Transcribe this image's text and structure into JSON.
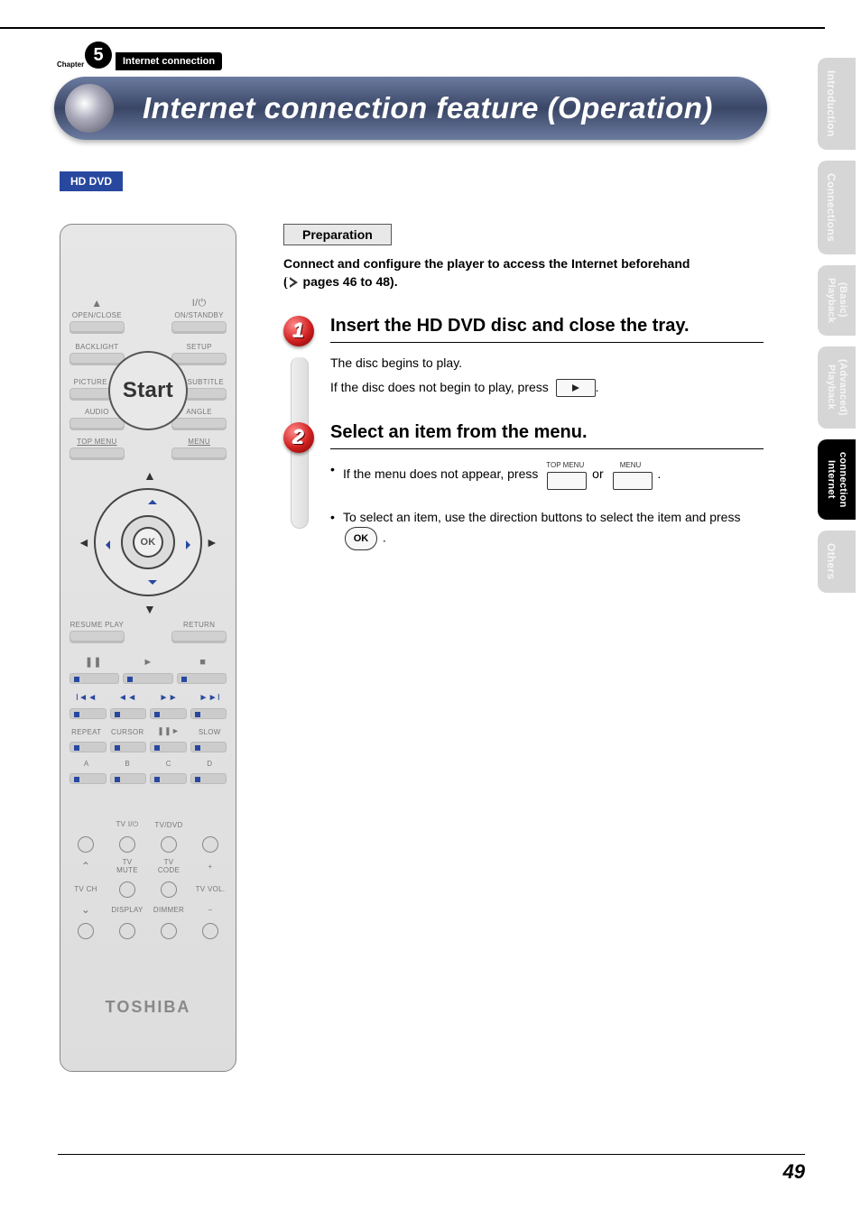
{
  "chapter": {
    "label_small": "Chapter",
    "number": "5",
    "name": "Internet connection"
  },
  "title": "Internet connection feature (Operation)",
  "badge": "HD DVD",
  "preparation": {
    "heading": "Preparation",
    "line1": "Connect and configure the player to access the Internet beforehand",
    "line2_prefix": "(",
    "line2_pages": " pages 46 to 48).",
    "icon_name": "link-arrow-icon"
  },
  "steps": [
    {
      "num": "1",
      "title": "Insert the HD DVD disc and close the tray.",
      "body": [
        {
          "type": "p",
          "text": "The disc begins to play."
        },
        {
          "type": "p_with_key",
          "before": "If the disc does not begin to play, press ",
          "key": {
            "kind": "play"
          },
          "after": "."
        }
      ]
    },
    {
      "num": "2",
      "title": "Select an item from the menu.",
      "body": [
        {
          "type": "bullet_keys",
          "before": " If the menu does not appear, press ",
          "keys": [
            {
              "label": "TOP MENU"
            },
            {
              "label": "MENU"
            }
          ],
          "mid": " or ",
          "after": " ."
        },
        {
          "type": "bullet_ok",
          "before": " To select an item, use the direction buttons to select the item and press ",
          "ok": "OK",
          "after": "."
        }
      ]
    }
  ],
  "side_tabs": [
    {
      "label": "Introduction",
      "active": false
    },
    {
      "label": "Connections",
      "active": false
    },
    {
      "label": "Playback (Basic)",
      "active": false,
      "twoLine": true,
      "l1": "Playback",
      "l2": "(Basic)"
    },
    {
      "label": "Playback (Advanced)",
      "active": false,
      "twoLine": true,
      "l1": "Playback",
      "l2": "(Advanced)"
    },
    {
      "label": "Internet connection",
      "active": true,
      "twoLine": true,
      "l1": "Internet",
      "l2": "connection"
    },
    {
      "label": "Others",
      "active": false
    }
  ],
  "remote": {
    "row1_left": "OPEN/CLOSE",
    "row1_right": "ON/STANDBY",
    "row2_left": "BACKLIGHT",
    "row2_right": "SETUP",
    "row3_left": "PICTURE",
    "row3_center": "Start",
    "row3_right": "SUBTITLE",
    "row4_left": "AUDIO",
    "row4_right": "ANGLE",
    "row5_left": "TOP MENU",
    "row5_right": "MENU",
    "ok": "OK",
    "row7_left": "RESUME PLAY",
    "row7_right": "RETURN",
    "row9_a": "REPEAT",
    "row9_b": "CURSOR",
    "row9_d": "SLOW",
    "row10_a": "A",
    "row10_b": "B",
    "row10_c": "C",
    "row10_d": "D",
    "tv_row_labels": {
      "tv_power": "TV",
      "tv_dvd": "TV/DVD",
      "tv_mute": "TV MUTE",
      "tv_code": "TV CODE",
      "tv_ch": "TV CH",
      "tv_vol": "TV VOL.",
      "display": "DISPLAY",
      "dimmer": "DIMMER"
    },
    "brand": "TOSHIBA"
  },
  "page_number": "49"
}
